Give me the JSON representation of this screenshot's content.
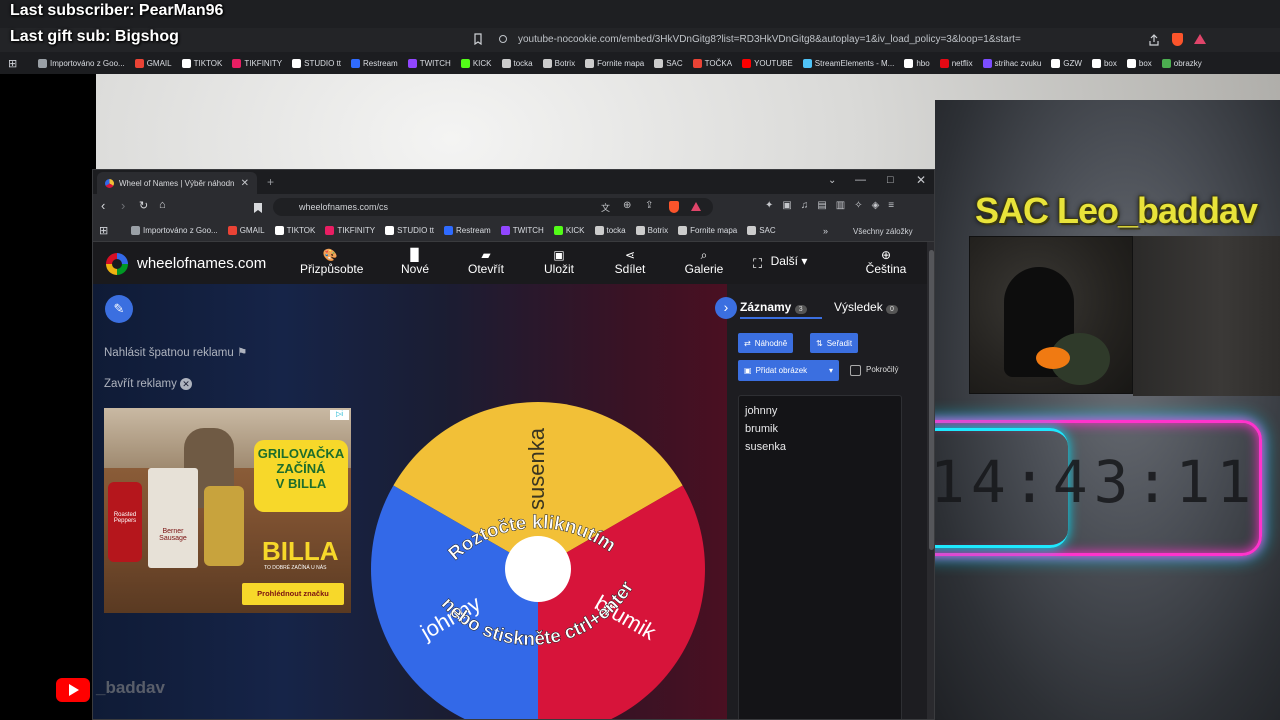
{
  "overlay": {
    "last_subscriber": "Last subscriber: PearMan96",
    "last_gift_sub": "Last gift sub: Bigshog",
    "channel_name": "SAC Leo_baddav",
    "channel_bottom": "_baddav",
    "clock": "14:43:11"
  },
  "outer_browser": {
    "url": "youtube-nocookie.com/embed/3HkVDnGitg8?list=RD3HkVDnGitg8&autoplay=1&iv_load_policy=3&loop=1&start=",
    "bookmarks": [
      "Importováno z Goo...",
      "GMAIL",
      "TIKTOK",
      "TIKFINITY",
      "STUDIO tt",
      "Restream",
      "TWITCH",
      "KICK",
      "tocka",
      "Botrix",
      "Fornite mapa",
      "SAC",
      "TOČKA",
      "YOUTUBE",
      "StreamElements - M...",
      "hbo",
      "netflix",
      "strihac zvuku",
      "GZW",
      "box",
      "box",
      "obrazky"
    ],
    "bookmark_colors": [
      "#9aa0a6",
      "#ea4335",
      "#ffffff",
      "#e91e63",
      "#ffffff",
      "#2f6bff",
      "#9146ff",
      "#53fc18",
      "#cccccc",
      "#cccccc",
      "#cccccc",
      "#cccccc",
      "#ea4335",
      "#ff0000",
      "#4fc3f7",
      "#ffffff",
      "#e50914",
      "#7c4dff",
      "#ffffff",
      "#ffffff",
      "#ffffff",
      "#4caf50"
    ]
  },
  "inner_browser": {
    "tab_title": "Wheel of Names | Výběr náhodn",
    "url": "wheelofnames.com/cs",
    "bookmarks": [
      "Importováno z Goo...",
      "GMAIL",
      "TIKTOK",
      "TIKFINITY",
      "STUDIO tt",
      "Restream",
      "TWITCH",
      "KICK",
      "tocka",
      "Botrix",
      "Fornite mapa",
      "SAC"
    ],
    "bookmark_colors": [
      "#9aa0a6",
      "#ea4335",
      "#ffffff",
      "#e91e63",
      "#ffffff",
      "#2f6bff",
      "#9146ff",
      "#53fc18",
      "#cccccc",
      "#cccccc",
      "#cccccc",
      "#cccccc"
    ],
    "all_bookmarks": "Všechny záložky"
  },
  "app": {
    "brand": "wheelofnames.com",
    "nav": [
      {
        "label": "Přizpůsobte",
        "icon": "palette-icon"
      },
      {
        "label": "Nové",
        "icon": "file-icon"
      },
      {
        "label": "Otevřít",
        "icon": "folder-icon"
      },
      {
        "label": "Uložit",
        "icon": "save-icon"
      },
      {
        "label": "Sdílet",
        "icon": "share-icon"
      },
      {
        "label": "Galerie",
        "icon": "search-icon"
      },
      {
        "label": "Další",
        "icon": "chevron-down-icon"
      },
      {
        "label": "Čeština",
        "icon": "globe-icon"
      }
    ],
    "report_ad": "Nahlásit špatnou reklamu",
    "close_ads": "Zavřít reklamy",
    "ad": {
      "headline_1": "GRILOVAČKA",
      "headline_2": "ZAČÍNÁ",
      "headline_3": "V BILLA",
      "brand": "BILLA",
      "slogan": "TO DOBRÉ ZAČÍNÁ U NÁS",
      "cta": "Prohlédnout značku",
      "jar_1": "Roasted Peppers",
      "jar_2": "Berner Sausage"
    },
    "wheel": {
      "instruction_top": "Roztočte kliknutím",
      "instruction_bottom": "nebo stiskněte ctrl+enter",
      "segments": [
        {
          "name": "susenka",
          "color": "#f2c037"
        },
        {
          "name": "brumik",
          "color": "#d7143a"
        },
        {
          "name": "johnny",
          "color": "#3369e8"
        }
      ]
    },
    "side": {
      "tab_entries": "Záznamy",
      "entries_count": "3",
      "tab_results": "Výsledek",
      "results_count": "0",
      "shuffle": "Náhodně",
      "sort": "Seřadit",
      "add_image": "Přidat obrázek",
      "advanced": "Pokročilý",
      "entries": [
        "johnny",
        "brumik",
        "susenka"
      ]
    }
  }
}
